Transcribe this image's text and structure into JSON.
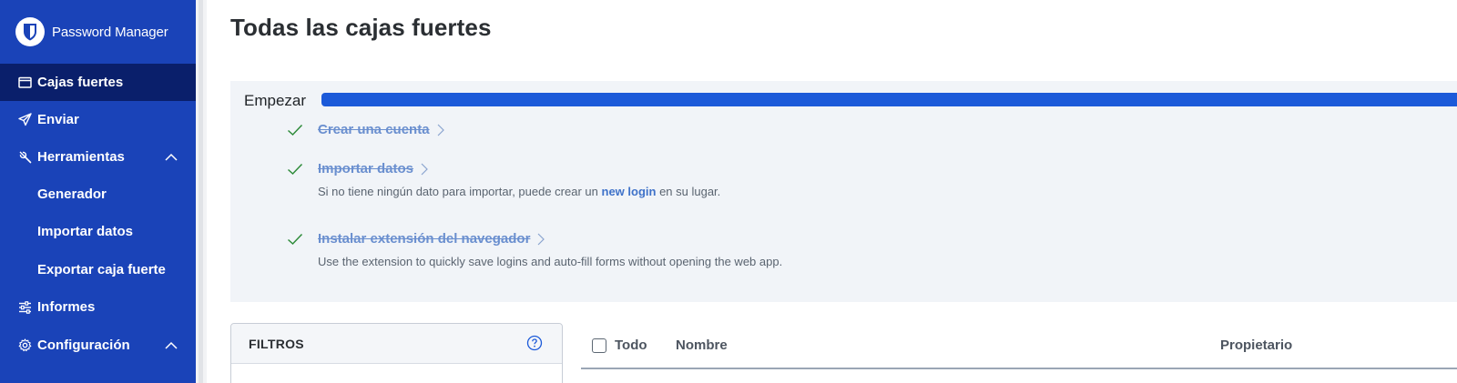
{
  "app": {
    "brand_name": "Password Manager"
  },
  "sidebar": {
    "items": [
      {
        "label": "Cajas fuertes",
        "icon": "vault-icon",
        "active": true
      },
      {
        "label": "Enviar",
        "icon": "send-icon"
      },
      {
        "label": "Herramientas",
        "icon": "wrench-icon",
        "expanded": true
      },
      {
        "label": "Generador",
        "sub": true
      },
      {
        "label": "Importar datos",
        "sub": true
      },
      {
        "label": "Exportar caja fuerte",
        "sub": true
      },
      {
        "label": "Informes",
        "icon": "sliders-icon"
      },
      {
        "label": "Configuración",
        "icon": "gear-icon",
        "expanded": true
      }
    ]
  },
  "main": {
    "title": "Todas las cajas fuertes"
  },
  "onboarding": {
    "title": "Empezar",
    "progress_percent": 100,
    "tasks": [
      {
        "label": "Crear una cuenta",
        "completed": true
      },
      {
        "label": "Importar datos",
        "completed": true,
        "desc_before": "Si no tiene ningún dato para importar, puede crear un ",
        "desc_link": "new login",
        "desc_after": " en su lugar."
      },
      {
        "label": "Instalar extensión del navegador",
        "completed": true,
        "desc": "Use the extension to quickly save logins and auto-fill forms without opening the web app."
      }
    ]
  },
  "filters": {
    "title": "FILTROS"
  },
  "table": {
    "select_all_label": "Todo",
    "columns": [
      "Nombre",
      "Propietario"
    ]
  },
  "colors": {
    "sidebar_bg": "#1a43b8",
    "sidebar_active": "#0a1f6b",
    "progress": "#1c5ad9",
    "check": "#2e8b3a"
  }
}
